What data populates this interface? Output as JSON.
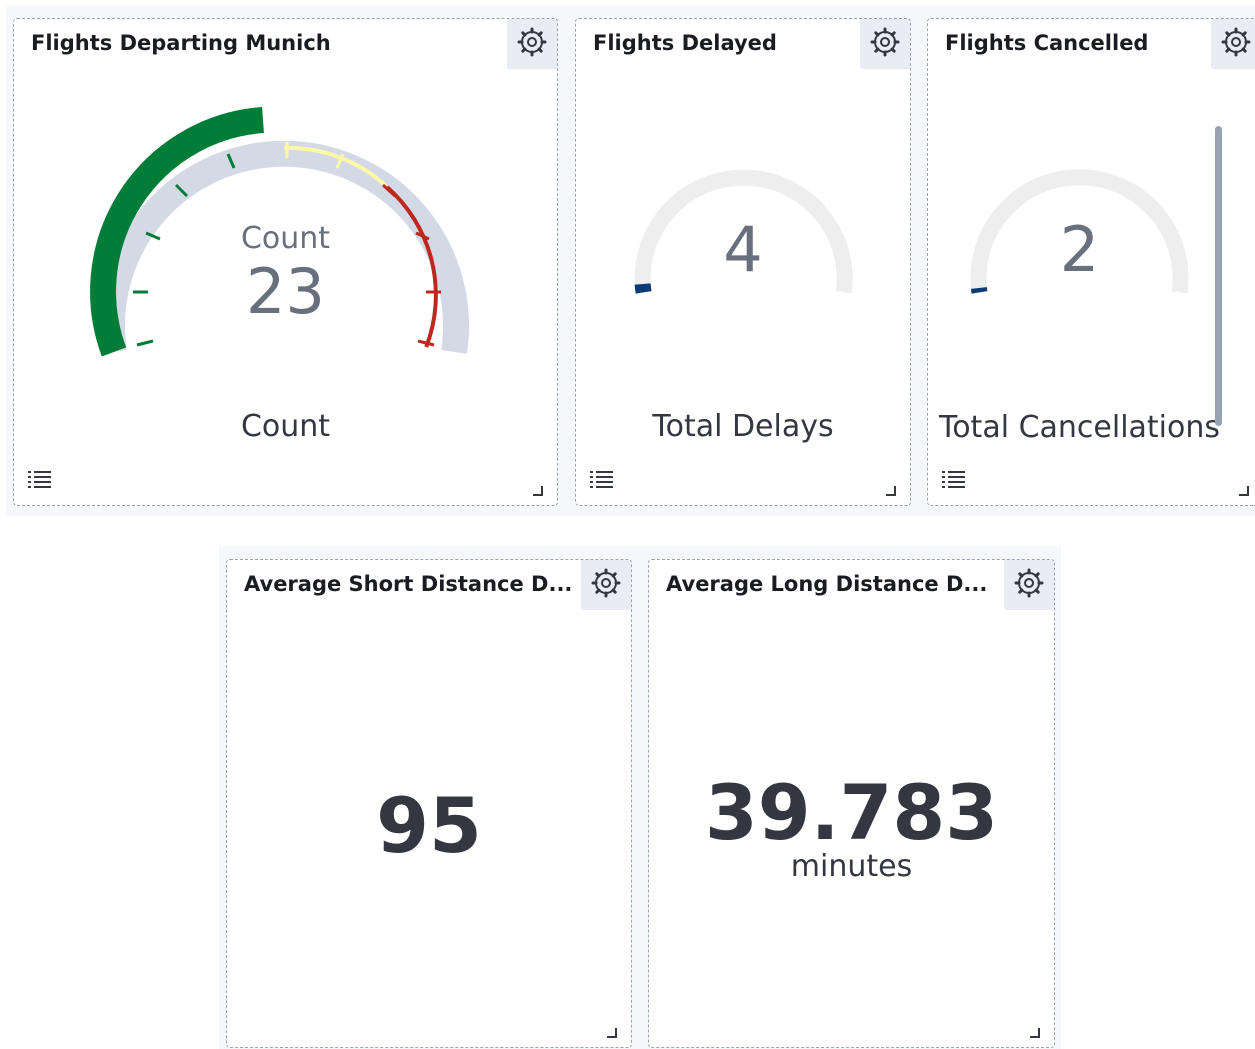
{
  "panels": {
    "munich": {
      "title": "Flights Departing Munich",
      "gauge_inner_label": "Count",
      "value": "23",
      "label": "Count",
      "range": [
        0,
        50
      ],
      "fill_fraction": 0.46,
      "color_bands": [
        {
          "color": "#017d37",
          "from": 0,
          "to": 0.46
        },
        {
          "color": "#d3dae6",
          "from": 0.46,
          "to": 1.0
        }
      ],
      "threshold_colors": [
        "#017d37",
        "#fff7a8",
        "#bd271e"
      ]
    },
    "delayed": {
      "title": "Flights Delayed",
      "value": "4",
      "label": "Total Delays",
      "fill_fraction": 0.02,
      "fill_color": "#0b3a77",
      "track_color": "#eeeeee"
    },
    "cancelled": {
      "title": "Flights Cancelled",
      "value": "2",
      "label": "Total Cancellations",
      "fill_fraction": 0.01,
      "fill_color": "#0b3a77",
      "track_color": "#eeeeee"
    },
    "short_distance": {
      "title": "Average Short Distance D...",
      "value": "95"
    },
    "long_distance": {
      "title": "Average Long Distance D...",
      "value": "39.783",
      "unit": "minutes"
    }
  },
  "icons": {
    "panel_options": "gear-icon",
    "legend_toggle": "list-icon",
    "resize": "resize-corner-icon"
  },
  "colors": {
    "background_band": "#f5f7fa",
    "panel_border": "#98a2b3",
    "gauge_green": "#017d37",
    "gauge_yellow": "#fff7a8",
    "gauge_red": "#bd271e",
    "gauge_track": "#d3dae6"
  }
}
